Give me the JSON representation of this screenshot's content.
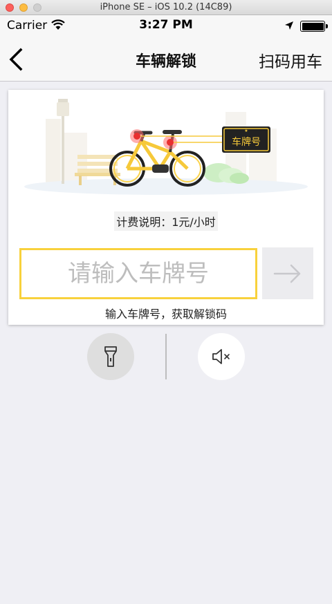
{
  "window": {
    "title": "iPhone SE – iOS 10.2 (14C89)"
  },
  "status_bar": {
    "carrier": "Carrier",
    "time": "3:27 PM",
    "battery_level": 1.0
  },
  "nav": {
    "back_icon": "chevron-left-icon",
    "title": "车辆解锁",
    "right_action": "扫码用车"
  },
  "card": {
    "illustration": {
      "plate_sign": "车牌号",
      "icon": "bike-illustration"
    },
    "fee_text": "计费说明：1元/小时",
    "input": {
      "placeholder": "请输入车牌号",
      "value": ""
    },
    "submit_icon": "arrow-right-icon",
    "hint": "输入车牌号，获取解锁码"
  },
  "tools": [
    {
      "icon": "flashlight-icon"
    },
    {
      "icon": "sound-mute-icon"
    }
  ],
  "colors": {
    "accent": "#f8d13c",
    "background": "#efeff4",
    "nav_bg": "#f7f7f7"
  }
}
